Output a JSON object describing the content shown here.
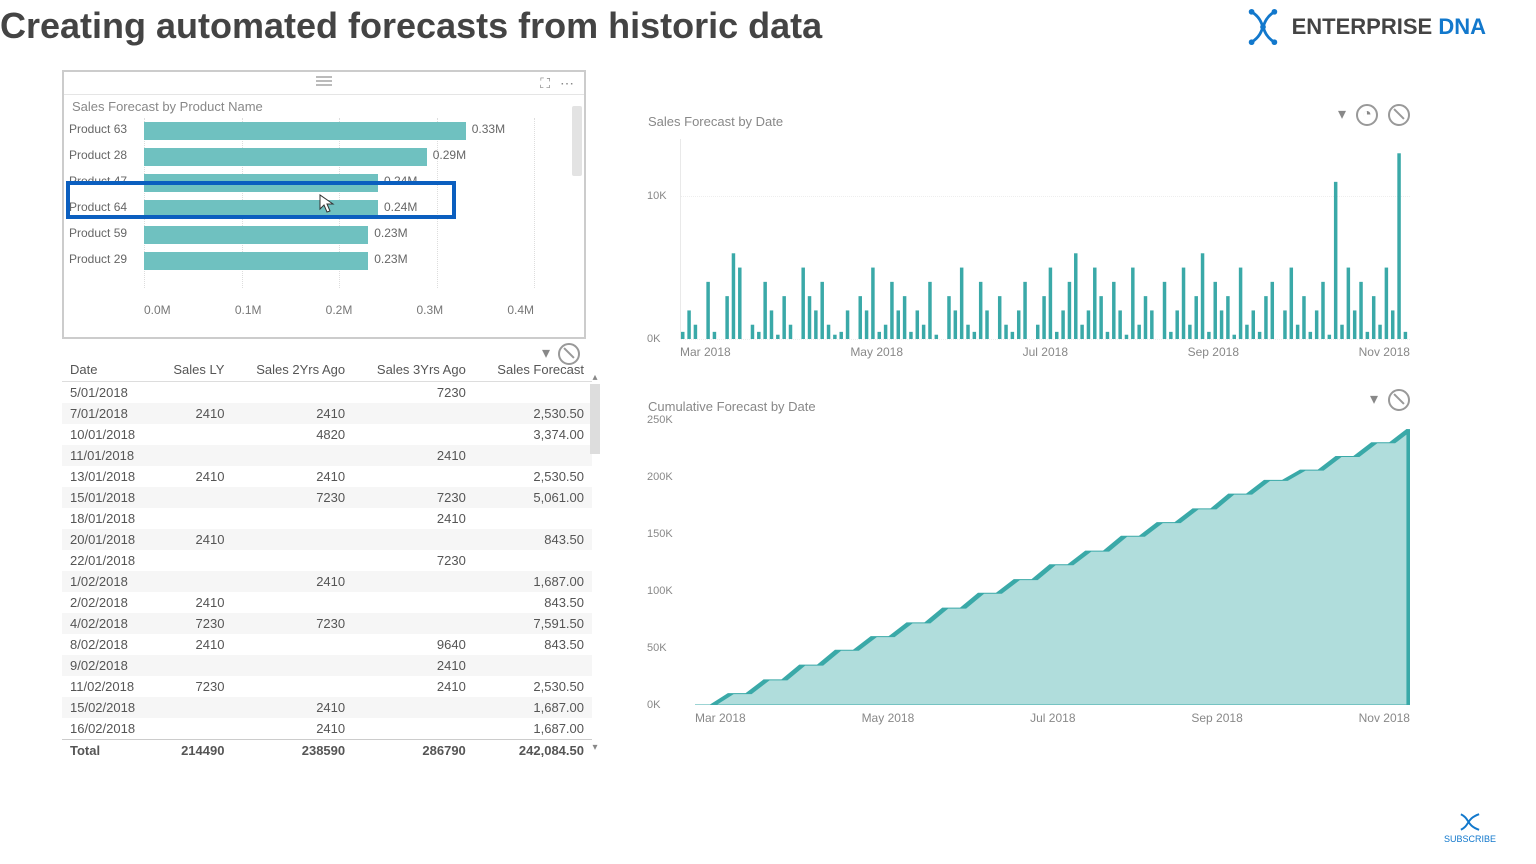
{
  "page_title": "Creating automated forecasts from historic data",
  "brand": {
    "name1": "ENTERPRISE ",
    "name2": "DNA"
  },
  "bar_chart_title": "Sales Forecast by Product Name",
  "line_chart_title": "Sales Forecast by Date",
  "area_chart_title": "Cumulative Forecast by Date",
  "table": {
    "headers": [
      "Date",
      "Sales LY",
      "Sales 2Yrs Ago",
      "Sales 3Yrs Ago",
      "Sales Forecast"
    ],
    "rows": [
      [
        "5/01/2018",
        "",
        "",
        "7230",
        ""
      ],
      [
        "7/01/2018",
        "2410",
        "2410",
        "",
        "2,530.50"
      ],
      [
        "10/01/2018",
        "",
        "4820",
        "",
        "3,374.00"
      ],
      [
        "11/01/2018",
        "",
        "",
        "2410",
        ""
      ],
      [
        "13/01/2018",
        "2410",
        "2410",
        "",
        "2,530.50"
      ],
      [
        "15/01/2018",
        "",
        "7230",
        "7230",
        "5,061.00"
      ],
      [
        "18/01/2018",
        "",
        "",
        "2410",
        ""
      ],
      [
        "20/01/2018",
        "2410",
        "",
        "",
        "843.50"
      ],
      [
        "22/01/2018",
        "",
        "",
        "7230",
        ""
      ],
      [
        "1/02/2018",
        "",
        "2410",
        "",
        "1,687.00"
      ],
      [
        "2/02/2018",
        "2410",
        "",
        "",
        "843.50"
      ],
      [
        "4/02/2018",
        "7230",
        "7230",
        "",
        "7,591.50"
      ],
      [
        "8/02/2018",
        "2410",
        "",
        "9640",
        "843.50"
      ],
      [
        "9/02/2018",
        "",
        "",
        "2410",
        ""
      ],
      [
        "11/02/2018",
        "7230",
        "",
        "2410",
        "2,530.50"
      ],
      [
        "15/02/2018",
        "",
        "2410",
        "",
        "1,687.00"
      ],
      [
        "16/02/2018",
        "",
        "2410",
        "",
        "1,687.00"
      ]
    ],
    "footer": [
      "Total",
      "214490",
      "238590",
      "286790",
      "242,084.50"
    ]
  },
  "chart_data": [
    {
      "type": "bar",
      "title": "Sales Forecast by Product Name",
      "orientation": "horizontal",
      "xlabel": "",
      "ylabel": "",
      "xlim": [
        0,
        0.4
      ],
      "xticks": [
        "0.0M",
        "0.1M",
        "0.2M",
        "0.3M",
        "0.4M"
      ],
      "categories": [
        "Product 63",
        "Product 28",
        "Product 47",
        "Product 64",
        "Product 59",
        "Product 29"
      ],
      "values": [
        0.33,
        0.29,
        0.24,
        0.24,
        0.23,
        0.23
      ],
      "value_labels": [
        "0.33M",
        "0.29M",
        "0.24M",
        "0.24M",
        "0.23M",
        "0.23M"
      ],
      "highlighted_index": 2
    },
    {
      "type": "bar",
      "title": "Sales Forecast by Date",
      "xlabel": "",
      "ylabel": "",
      "ylim": [
        0,
        14
      ],
      "yticks": [
        "0K",
        "10K"
      ],
      "xticks": [
        "Mar 2018",
        "May 2018",
        "Jul 2018",
        "Sep 2018",
        "Nov 2018"
      ],
      "note": "dense daily bars; approximate heights in K",
      "values": [
        0.5,
        2,
        1,
        0,
        4,
        0.5,
        0,
        3,
        6,
        5,
        0,
        1,
        0.5,
        4,
        2,
        0.3,
        3,
        1,
        0,
        5,
        3,
        2,
        4,
        1,
        0.3,
        0.5,
        2,
        0,
        3,
        2,
        5,
        0.5,
        1,
        4,
        2,
        3,
        0.5,
        2,
        1,
        4,
        0.3,
        0,
        3,
        2,
        5,
        1,
        0.5,
        4,
        2,
        0,
        3,
        1,
        0.5,
        2,
        4,
        0,
        1,
        3,
        5,
        0.5,
        2,
        4,
        6,
        1,
        2,
        5,
        3,
        0.5,
        4,
        2,
        0.3,
        5,
        1,
        3,
        2,
        0,
        4,
        0.5,
        2,
        5,
        1,
        3,
        6,
        0.5,
        4,
        2,
        3,
        0.3,
        5,
        1,
        2,
        0.5,
        3,
        4,
        0,
        2,
        5,
        1,
        3,
        0.5,
        2,
        4,
        0.3,
        11,
        1,
        5,
        2,
        4,
        0.5,
        3,
        1,
        5,
        2,
        13,
        0.5
      ]
    },
    {
      "type": "area",
      "title": "Cumulative Forecast by Date",
      "xlabel": "",
      "ylabel": "",
      "ylim": [
        0,
        250
      ],
      "yticks": [
        "0K",
        "50K",
        "100K",
        "150K",
        "200K",
        "250K"
      ],
      "xticks": [
        "Mar 2018",
        "May 2018",
        "Jul 2018",
        "Sep 2018",
        "Nov 2018"
      ],
      "x": [
        0,
        0.05,
        0.1,
        0.15,
        0.2,
        0.25,
        0.3,
        0.35,
        0.4,
        0.45,
        0.5,
        0.55,
        0.6,
        0.65,
        0.7,
        0.75,
        0.8,
        0.85,
        0.9,
        0.95,
        1.0
      ],
      "values": [
        0,
        10,
        22,
        35,
        48,
        60,
        72,
        85,
        98,
        110,
        123,
        135,
        148,
        160,
        172,
        185,
        197,
        206,
        218,
        230,
        242
      ]
    }
  ],
  "subscribe_label": "SUBSCRIBE"
}
